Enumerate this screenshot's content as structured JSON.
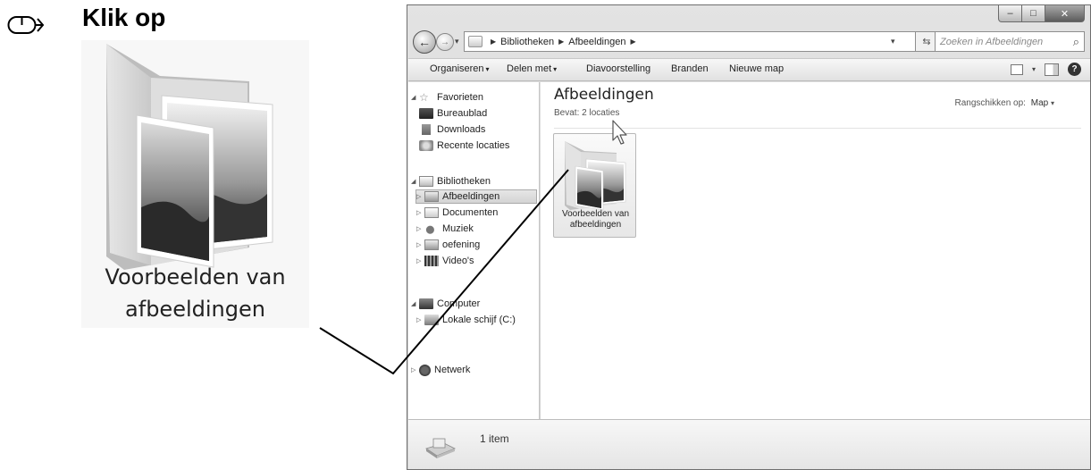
{
  "instruction": {
    "label": "Klik op",
    "icon": "mouse-click-icon"
  },
  "zoom_preview": {
    "caption_line1": "Voorbeelden van",
    "caption_line2": "afbeeldingen",
    "icon": "folder-with-pictures-icon"
  },
  "window": {
    "controls": {
      "minimize": "minimize-icon",
      "maximize": "maximize-icon",
      "close": "close-icon"
    },
    "address": {
      "segments": [
        "Bibliotheken",
        "Afbeeldingen"
      ],
      "search_placeholder": "Zoeken in Afbeeldingen"
    },
    "commands": {
      "organize": "Organiseren",
      "share": "Delen met",
      "slideshow": "Diavoorstelling",
      "burn": "Branden",
      "new_folder": "Nieuwe map"
    },
    "nav": {
      "favorites": "Favorieten",
      "desktop": "Bureaublad",
      "downloads": "Downloads",
      "recent": "Recente locaties",
      "libraries": "Bibliotheken",
      "pictures": "Afbeeldingen",
      "documents": "Documenten",
      "music": "Muziek",
      "exercise": "oefening",
      "videos": "Video's",
      "computer": "Computer",
      "local_disk": "Lokale schijf (C:)",
      "network": "Netwerk"
    },
    "content": {
      "title": "Afbeeldingen",
      "subtitle": "Bevat: 2 locaties",
      "arrange_label": "Rangschikken op:",
      "arrange_value": "Map",
      "item_line1": "Voorbeelden van",
      "item_line2": "afbeeldingen"
    },
    "details": {
      "count": "1 item"
    }
  }
}
